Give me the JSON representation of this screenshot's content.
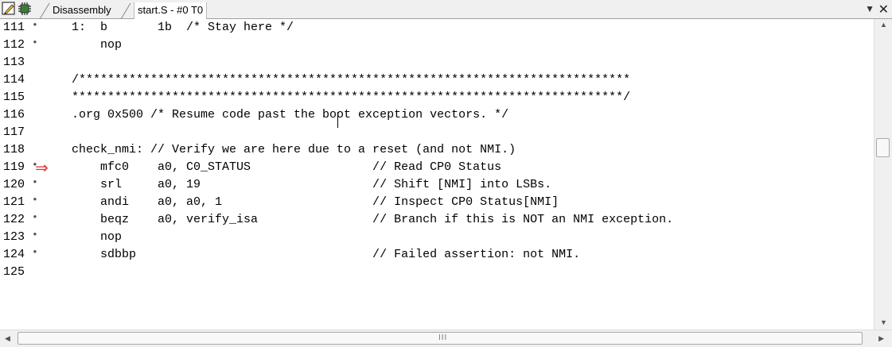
{
  "tabs": {
    "items": [
      {
        "label": "Disassembly"
      },
      {
        "label": "start.S - #0 T0"
      }
    ],
    "menu_icon": "dropdown-arrow-icon",
    "close_icon": "close-icon"
  },
  "editor": {
    "lines": [
      {
        "num": "111",
        "marker": "•",
        "arrow": "",
        "code": "1:  b       1b  /* Stay here */"
      },
      {
        "num": "112",
        "marker": "•",
        "arrow": "",
        "code": "    nop"
      },
      {
        "num": "113",
        "marker": "",
        "arrow": "",
        "code": ""
      },
      {
        "num": "114",
        "marker": "",
        "arrow": "",
        "code": "/*****************************************************************************"
      },
      {
        "num": "115",
        "marker": "",
        "arrow": "",
        "code": "*****************************************************************************/"
      },
      {
        "num": "116",
        "marker": "",
        "arrow": "",
        "code": ".org 0x500 /* Resume code past the boot exception vectors. */"
      },
      {
        "num": "117",
        "marker": "",
        "arrow": "",
        "code": ""
      },
      {
        "num": "118",
        "marker": "",
        "arrow": "",
        "code": "check_nmi: // Verify we are here due to a reset (and not NMI.)"
      },
      {
        "num": "119",
        "marker": "•",
        "arrow": "⇒",
        "code": "    mfc0    a0, C0_STATUS                 // Read CP0 Status"
      },
      {
        "num": "120",
        "marker": "•",
        "arrow": "",
        "code": "    srl     a0, 19                        // Shift [NMI] into LSBs."
      },
      {
        "num": "121",
        "marker": "•",
        "arrow": "",
        "code": "    andi    a0, a0, 1                     // Inspect CP0 Status[NMI]"
      },
      {
        "num": "122",
        "marker": "•",
        "arrow": "",
        "code": "    beqz    a0, verify_isa                // Branch if this is NOT an NMI exception."
      },
      {
        "num": "123",
        "marker": "•",
        "arrow": "",
        "code": "    nop"
      },
      {
        "num": "124",
        "marker": "•",
        "arrow": "",
        "code": "    sdbbp                                 // Failed assertion: not NMI."
      },
      {
        "num": "125",
        "marker": "",
        "arrow": "",
        "code": ""
      }
    ]
  },
  "scrollbars": {
    "up": "▲",
    "down": "▼",
    "left": "◀",
    "right": "▶",
    "grip": "III"
  },
  "colors": {
    "arrow": "#e03030",
    "chrome": "#f0f0f0"
  }
}
